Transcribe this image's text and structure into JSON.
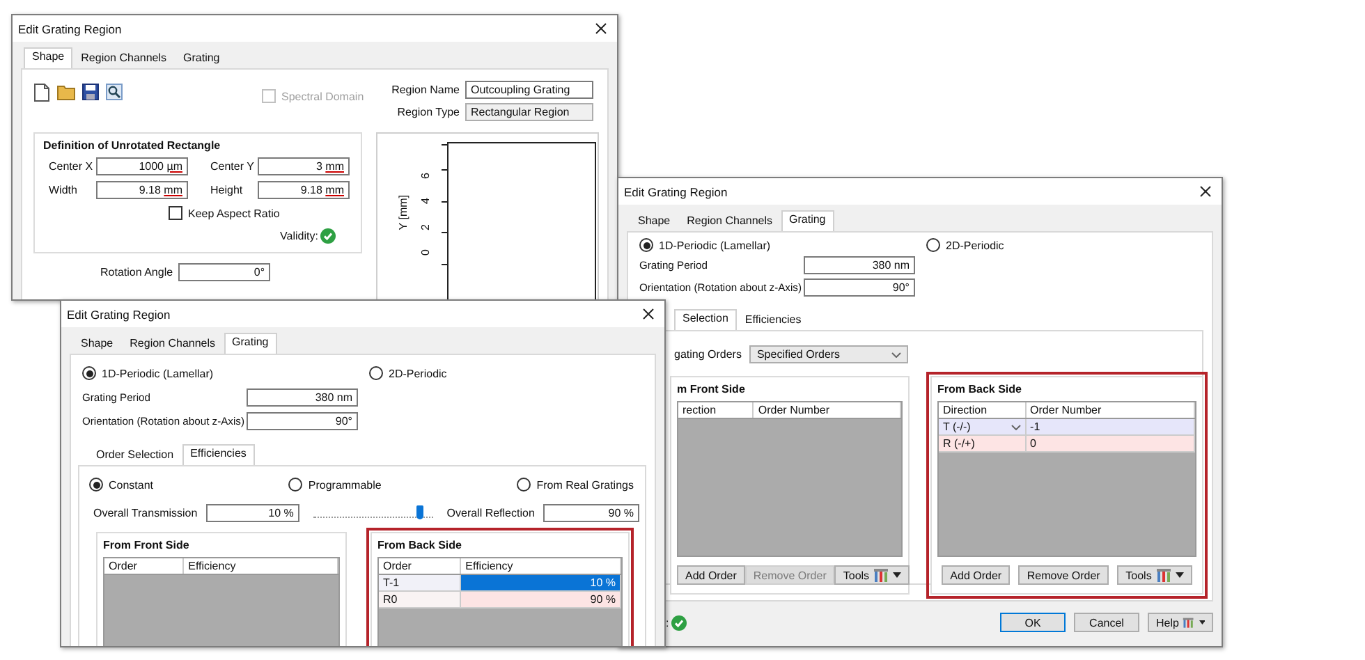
{
  "windows": [
    {
      "kind": "shape",
      "title": "Edit Grating Region",
      "tabs": [
        {
          "label": "Shape",
          "selected": true
        },
        {
          "label": "Region Channels",
          "selected": false
        },
        {
          "label": "Grating",
          "selected": false
        }
      ],
      "spectral_domain": {
        "label": "Spectral Domain",
        "checked": false,
        "disabled": true
      },
      "region_name": {
        "label": "Region Name",
        "value": "Outcoupling Grating"
      },
      "region_type": {
        "label": "Region Type",
        "value": "Rectangular Region"
      },
      "definition": {
        "title": "Definition of Unrotated Rectangle",
        "fields": [
          {
            "label": "Center X",
            "value": "1000",
            "unit": "µm"
          },
          {
            "label": "Center Y",
            "value": "3",
            "unit": "mm"
          },
          {
            "label": "Width",
            "value": "9.18",
            "unit": "mm"
          },
          {
            "label": "Height",
            "value": "9.18",
            "unit": "mm"
          }
        ],
        "keep_aspect_ratio": {
          "label": "Keep Aspect Ratio",
          "checked": false
        },
        "validity": {
          "label": "Validity:",
          "valid": true
        }
      },
      "rotation_angle": {
        "label": "Rotation Angle",
        "value": "0°"
      },
      "plot": {
        "ylabel": "Y [mm]",
        "yticks": [
          "6",
          "4",
          "2",
          "0"
        ]
      }
    },
    {
      "kind": "orders",
      "title": "Edit Grating Region",
      "tabs": [
        {
          "label": "Shape",
          "selected": false
        },
        {
          "label": "Region Channels",
          "selected": false
        },
        {
          "label": "Grating",
          "selected": true
        }
      ],
      "grating_type": [
        {
          "label": "1D-Periodic (Lamellar)",
          "selected": true
        },
        {
          "label": "2D-Periodic",
          "selected": false
        }
      ],
      "grating_period": {
        "label": "Grating Period",
        "value": "380 nm"
      },
      "orientation": {
        "label": "Orientation (Rotation about z-Axis)",
        "value": "90°"
      },
      "sub_tabs": [
        {
          "label": "Selection",
          "selected": true
        },
        {
          "label": "Efficiencies",
          "selected": false
        }
      ],
      "propagating": {
        "label": "gating Orders",
        "value": "Specified Orders"
      },
      "front": {
        "title": "m Front Side",
        "highlighted": false,
        "columns": [
          "rection",
          "Order Number"
        ],
        "buttons": [
          {
            "label": "Add Order",
            "disabled": false
          },
          {
            "label": "Remove Order",
            "disabled": true
          },
          {
            "label": "Tools",
            "disabled": false
          }
        ]
      },
      "back": {
        "title": "From Back Side",
        "highlighted": true,
        "columns": [
          "Direction",
          "Order Number"
        ],
        "rows": [
          {
            "kind": "transmission",
            "cells": [
              "T (-/-)",
              "-1"
            ],
            "dropdown": true,
            "selected": false
          },
          {
            "kind": "reflection",
            "cells": [
              "R (-/+)",
              "0"
            ],
            "dropdown": false,
            "selected": false
          }
        ],
        "buttons": [
          {
            "label": "Add Order",
            "disabled": false
          },
          {
            "label": "Remove Order",
            "disabled": false
          },
          {
            "label": "Tools",
            "disabled": false
          }
        ]
      },
      "validity": {
        "label": ":",
        "valid": true
      },
      "dialog_buttons": [
        {
          "label": "OK",
          "default": true
        },
        {
          "label": "Cancel",
          "default": false
        },
        {
          "label": "Help",
          "default": false
        }
      ]
    },
    {
      "kind": "efficiencies",
      "title": "Edit Grating Region",
      "tabs": [
        {
          "label": "Shape",
          "selected": false
        },
        {
          "label": "Region Channels",
          "selected": false
        },
        {
          "label": "Grating",
          "selected": true
        }
      ],
      "grating_type": [
        {
          "label": "1D-Periodic (Lamellar)",
          "selected": true
        },
        {
          "label": "2D-Periodic",
          "selected": false
        }
      ],
      "grating_period": {
        "label": "Grating Period",
        "value": "380 nm"
      },
      "orientation": {
        "label": "Orientation (Rotation about z-Axis)",
        "value": "90°"
      },
      "sub_tabs": [
        {
          "label": "Order Selection",
          "selected": false
        },
        {
          "label": "Efficiencies",
          "selected": true
        }
      ],
      "mode": [
        {
          "label": "Constant",
          "selected": true
        },
        {
          "label": "Programmable",
          "selected": false
        },
        {
          "label": "From Real Gratings",
          "selected": false
        }
      ],
      "transmission": {
        "label": "Overall Transmission",
        "value": "10 %"
      },
      "balance": {
        "level": 0.9
      },
      "reflection": {
        "label": "Overall Reflection",
        "value": "90 %"
      },
      "front": {
        "title": "From Front Side",
        "highlighted": false,
        "columns": [
          "Order",
          "Efficiency"
        ]
      },
      "back": {
        "title": "From Back Side",
        "highlighted": true,
        "columns": [
          "Order",
          "Efficiency"
        ],
        "rows": [
          {
            "kind": "transmission",
            "cells": [
              "T-1",
              "10 %"
            ],
            "dropdown": false,
            "selected": true
          },
          {
            "kind": "reflection",
            "cells": [
              "R0",
              "90 %"
            ],
            "dropdown": false,
            "selected": false
          }
        ]
      }
    }
  ]
}
